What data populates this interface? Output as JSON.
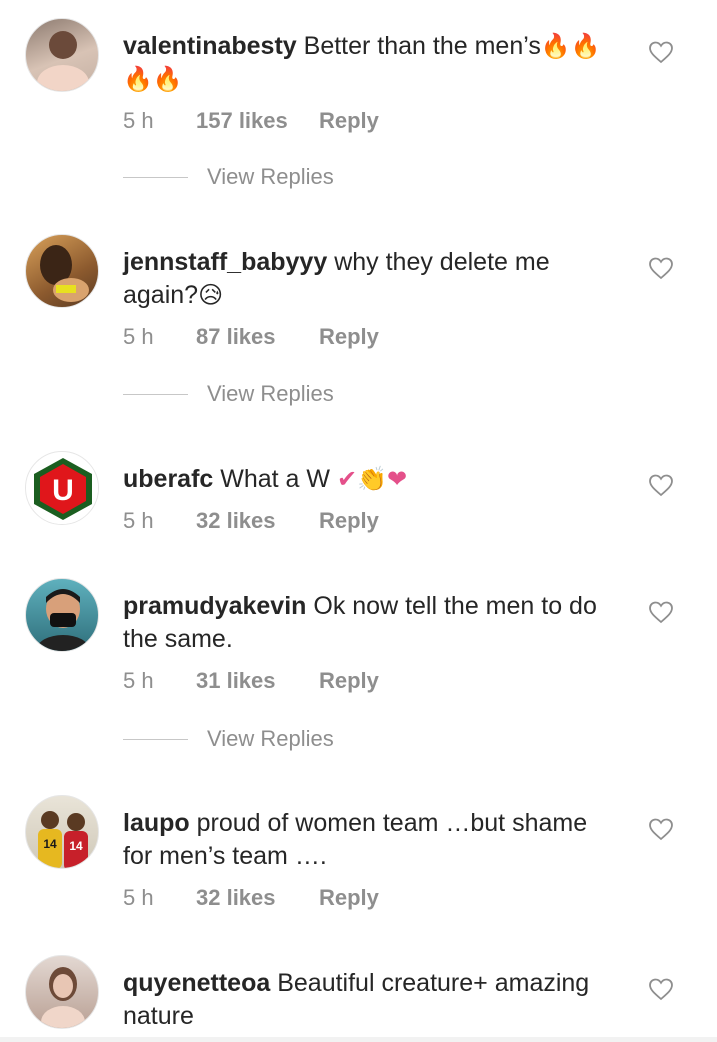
{
  "comments": [
    {
      "username": "valentinabesty",
      "text": "Better than the men’s",
      "emoji": "🔥🔥🔥🔥",
      "time": "5 h",
      "likes": "157 likes",
      "reply": "Reply",
      "view_replies": "View Replies",
      "avatar_color": "#b9a79a"
    },
    {
      "username": "jennstaff_babyyy",
      "text": "why they delete me again?",
      "emoji": "😥",
      "time": "5 h",
      "likes": "87 likes",
      "reply": "Reply",
      "view_replies": "View Replies",
      "avatar_color": "#a9794d"
    },
    {
      "username": "uberafc",
      "text": "What a W",
      "emoji": "✔👏❤",
      "time": "5 h",
      "likes": "32 likes",
      "reply": "Reply",
      "avatar_color": "#e0161b"
    },
    {
      "username": "pramudyakevin",
      "text": "Ok now tell the men to do the same.",
      "emoji": "",
      "time": "5 h",
      "likes": "31 likes",
      "reply": "Reply",
      "view_replies": "View Replies",
      "avatar_color": "#4a8f9c"
    },
    {
      "username": "laupo",
      "text": "proud of women team …but shame for men’s team ….",
      "emoji": "",
      "time": "5 h",
      "likes": "32 likes",
      "reply": "Reply",
      "avatar_color": "#c9a44a"
    },
    {
      "username": "quyenetteoa",
      "text": "Beautiful creature+ amazing nature",
      "emoji": "",
      "avatar_color": "#cbb3a6"
    }
  ]
}
